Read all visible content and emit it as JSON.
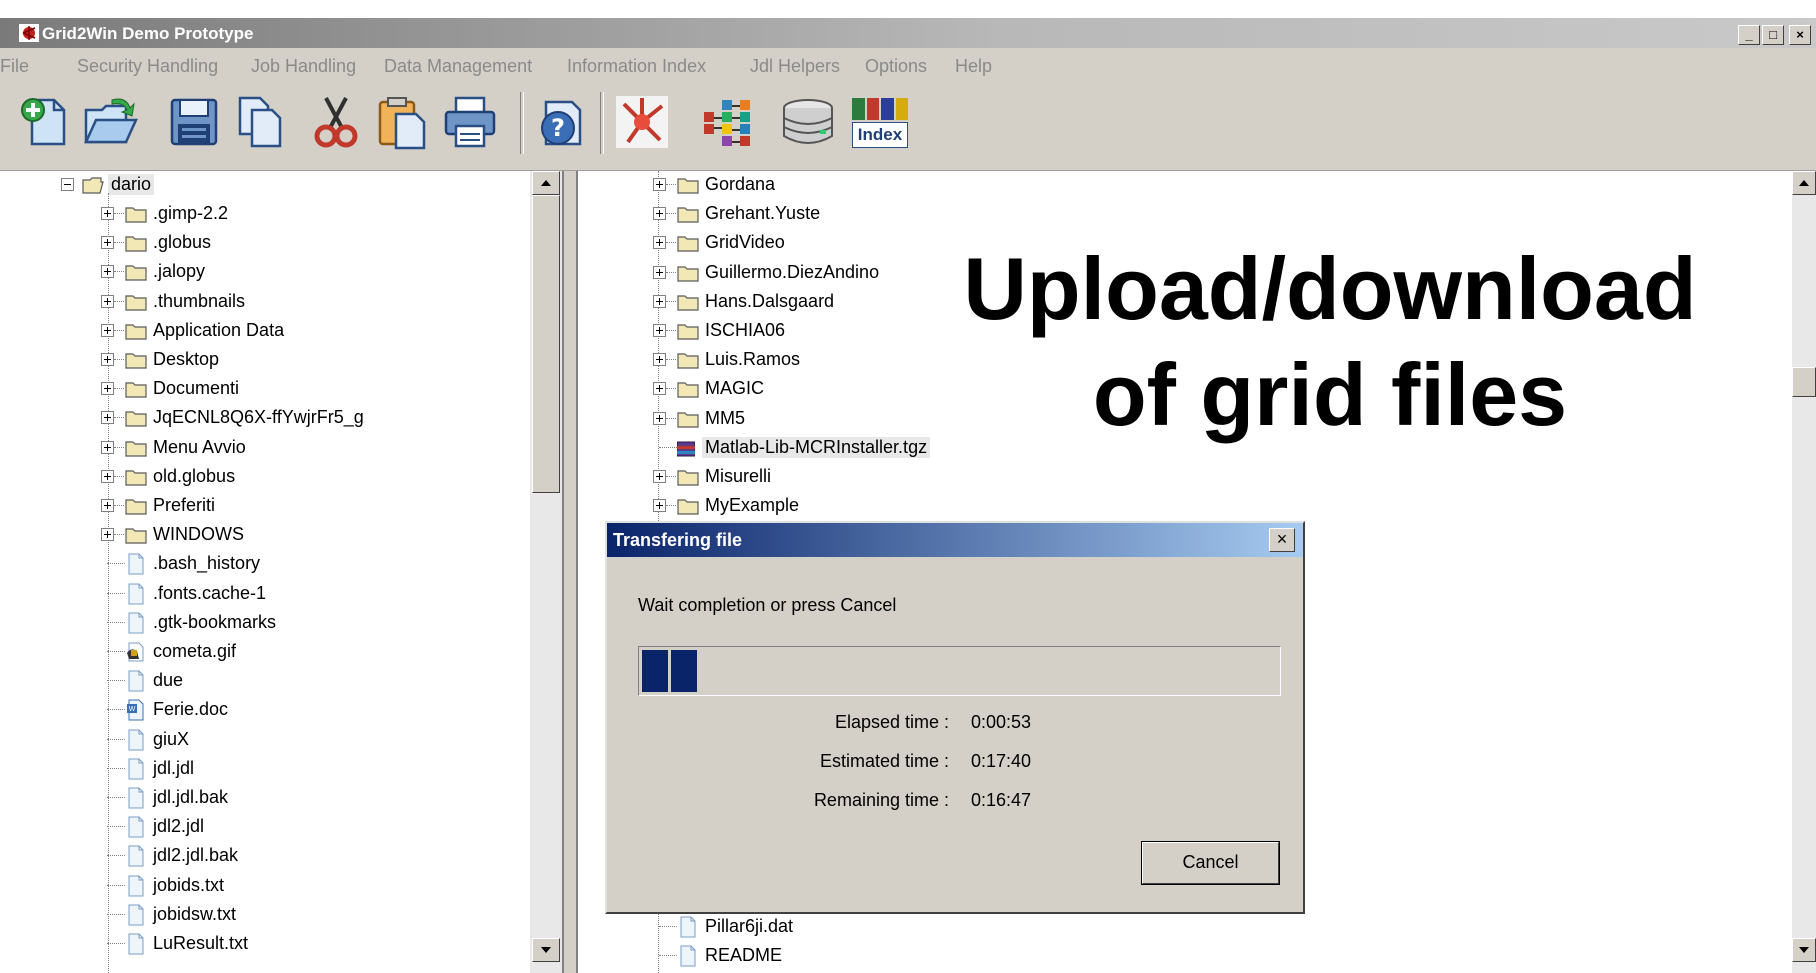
{
  "window": {
    "title": "Grid2Win Demo Prototype",
    "minimize": "_",
    "maximize": "□",
    "close": "×"
  },
  "menu": [
    "File",
    "Security Handling",
    "Job Handling",
    "Data Management",
    "Information Index",
    "Jdl Helpers",
    "Options",
    "Help"
  ],
  "toolbar": [
    {
      "name": "new-icon"
    },
    {
      "name": "open-icon"
    },
    {
      "name": "save-icon"
    },
    {
      "name": "copy-icon"
    },
    {
      "name": "cut-icon"
    },
    {
      "name": "paste-icon"
    },
    {
      "name": "print-icon"
    },
    {
      "name": "help-icon"
    },
    {
      "name": "grid-logo-icon"
    },
    {
      "name": "job-icon"
    },
    {
      "name": "storage-icon"
    },
    {
      "name": "index-icon",
      "label": "Index"
    }
  ],
  "left_tree": {
    "root": "dario",
    "items": [
      {
        "label": ".gimp-2.2",
        "type": "folder"
      },
      {
        "label": ".globus",
        "type": "folder"
      },
      {
        "label": ".jalopy",
        "type": "folder"
      },
      {
        "label": ".thumbnails",
        "type": "folder"
      },
      {
        "label": "Application Data",
        "type": "folder"
      },
      {
        "label": "Desktop",
        "type": "folder"
      },
      {
        "label": "Documenti",
        "type": "folder"
      },
      {
        "label": "JqECNL8Q6X-ffYwjrFr5_g",
        "type": "folder"
      },
      {
        "label": "Menu Avvio",
        "type": "folder"
      },
      {
        "label": "old.globus",
        "type": "folder"
      },
      {
        "label": "Preferiti",
        "type": "folder"
      },
      {
        "label": "WINDOWS",
        "type": "folder"
      },
      {
        "label": ".bash_history",
        "type": "file"
      },
      {
        "label": ".fonts.cache-1",
        "type": "file"
      },
      {
        "label": ".gtk-bookmarks",
        "type": "file"
      },
      {
        "label": "cometa.gif",
        "type": "image"
      },
      {
        "label": "due",
        "type": "file"
      },
      {
        "label": "Ferie.doc",
        "type": "doc"
      },
      {
        "label": "giuX",
        "type": "file"
      },
      {
        "label": "jdl.jdl",
        "type": "file"
      },
      {
        "label": "jdl.jdl.bak",
        "type": "file"
      },
      {
        "label": "jdl2.jdl",
        "type": "file"
      },
      {
        "label": "jdl2.jdl.bak",
        "type": "file"
      },
      {
        "label": "jobids.txt",
        "type": "file"
      },
      {
        "label": "jobidsw.txt",
        "type": "file"
      },
      {
        "label": "LuResult.txt",
        "type": "file"
      }
    ]
  },
  "right_tree": {
    "items": [
      {
        "label": "Gordana",
        "type": "folder"
      },
      {
        "label": "Grehant.Yuste",
        "type": "folder"
      },
      {
        "label": "GridVideo",
        "type": "folder"
      },
      {
        "label": "Guillermo.DiezAndino",
        "type": "folder"
      },
      {
        "label": "Hans.Dalsgaard",
        "type": "folder"
      },
      {
        "label": "ISCHIA06",
        "type": "folder"
      },
      {
        "label": "Luis.Ramos",
        "type": "folder"
      },
      {
        "label": "MAGIC",
        "type": "folder"
      },
      {
        "label": "MM5",
        "type": "folder"
      },
      {
        "label": "Matlab-Lib-MCRInstaller.tgz",
        "type": "archive",
        "selected": true
      },
      {
        "label": "Misurelli",
        "type": "folder"
      },
      {
        "label": "MyExample",
        "type": "folder"
      }
    ],
    "bottom_items": [
      {
        "label": "Pillar6ji.dat",
        "type": "file"
      },
      {
        "label": "README",
        "type": "file"
      }
    ]
  },
  "overlay": {
    "line1": "Upload/download",
    "line2": "of grid files"
  },
  "dialog": {
    "title": "Transfering file",
    "close": "×",
    "message": "Wait completion or press Cancel",
    "progress": 0.09,
    "elapsed_label": "Elapsed time :",
    "elapsed_value": "0:00:53",
    "estimated_label": "Estimated time :",
    "estimated_value": "0:17:40",
    "remaining_label": "Remaining time :",
    "remaining_value": "0:16:47",
    "cancel": "Cancel"
  },
  "colors": {
    "titlebar": "#7a7a7a",
    "dialog_title": "#0a246a",
    "progress_fill": "#0a246a",
    "chrome": "#d4d0c8",
    "folder": "#f1e8b6"
  }
}
